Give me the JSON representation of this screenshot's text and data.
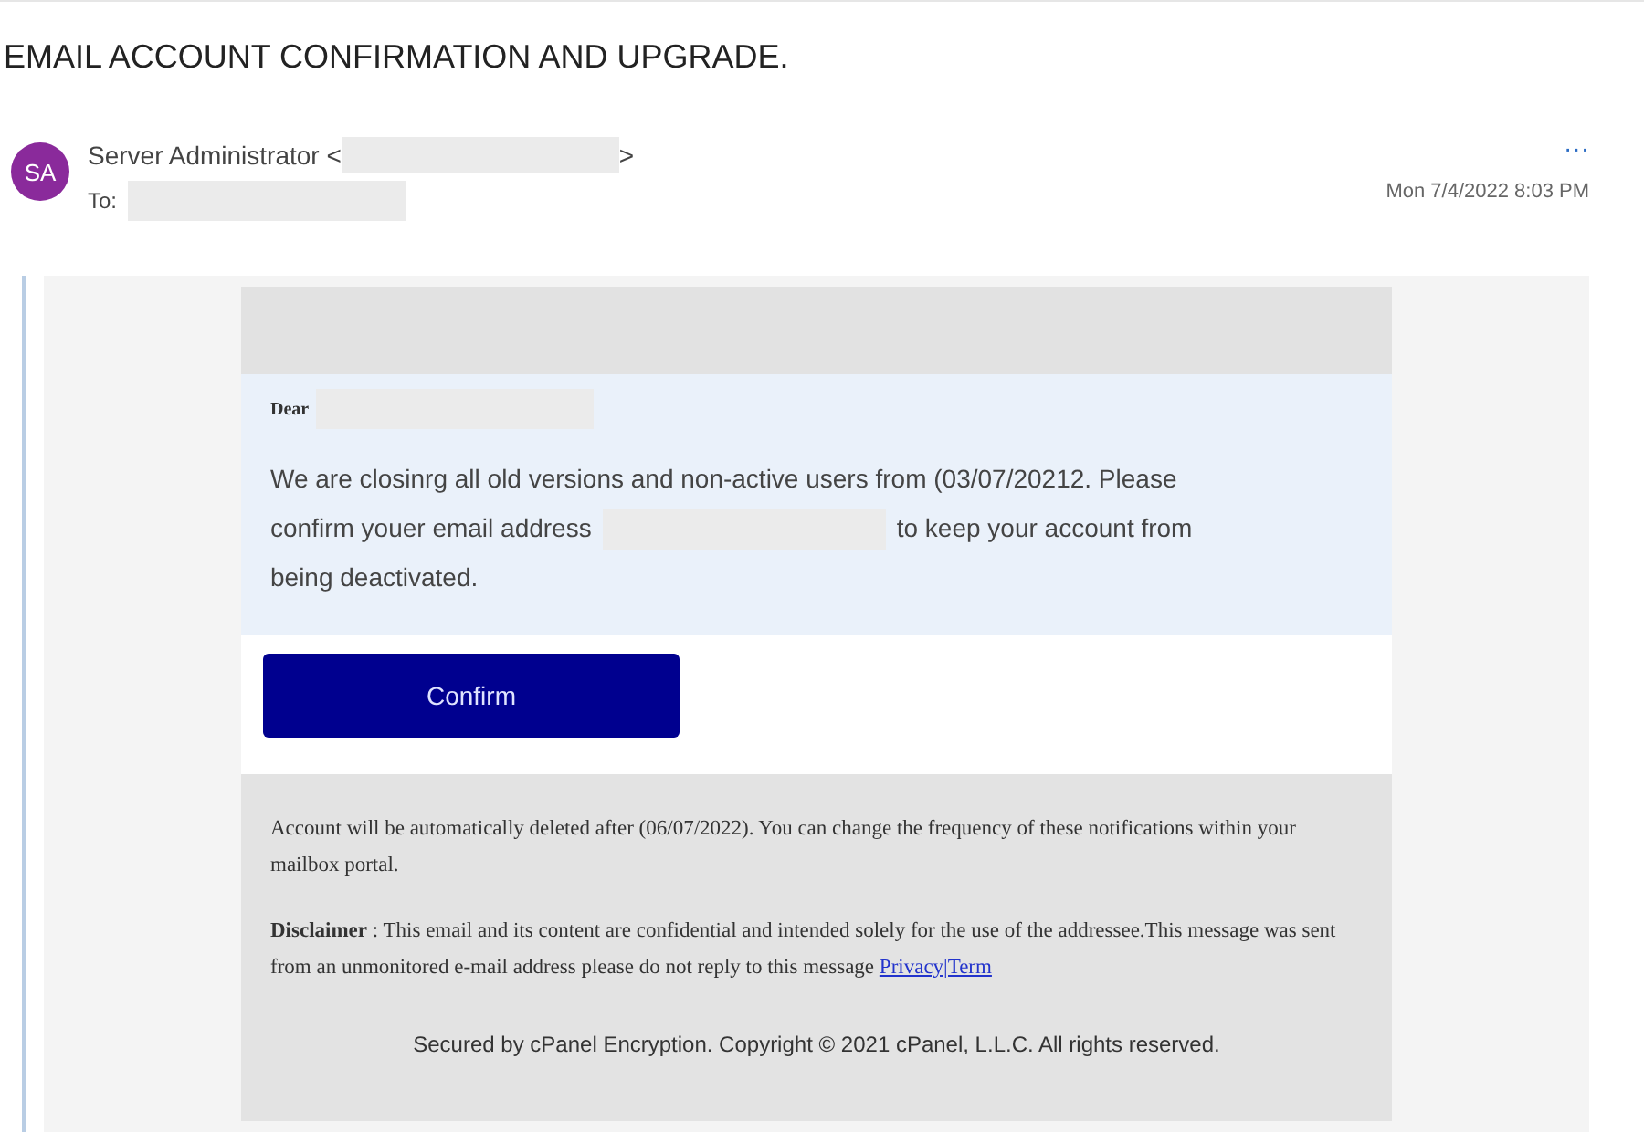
{
  "subject": "EMAIL ACCOUNT CONFIRMATION AND UPGRADE.",
  "sender": {
    "initials": "SA",
    "name": "Server Administrator <",
    "name_end": ">",
    "to_label": "To:",
    "date": "Mon 7/4/2022 8:03 PM",
    "more": "···"
  },
  "message": {
    "greeting": "Dear",
    "body_line_1": "We are closinrg all old versions and non-active users from (03/07/20212. Please",
    "body_line_2_before": "confirm youer email address",
    "body_line_2_after": "to keep your account from",
    "body_line_3": "being deactivated.",
    "button": "Confirm",
    "notice": "Account will be  automatically deleted after (06/07/2022). You can change the frequency of these notifications within your mailbox portal.",
    "disclaimer": "**Disclaimer** : This email and its content are confidential and intended solely for the use of the addressee.This message was sent from an unmonitored e-mail address please do not reply to this message",
    "link": "Privacy|Term",
    "copyright": "Secured by cPanel Encryption. Copyright © 2021 cPanel, L.L.C. All rights reserved."
  }
}
